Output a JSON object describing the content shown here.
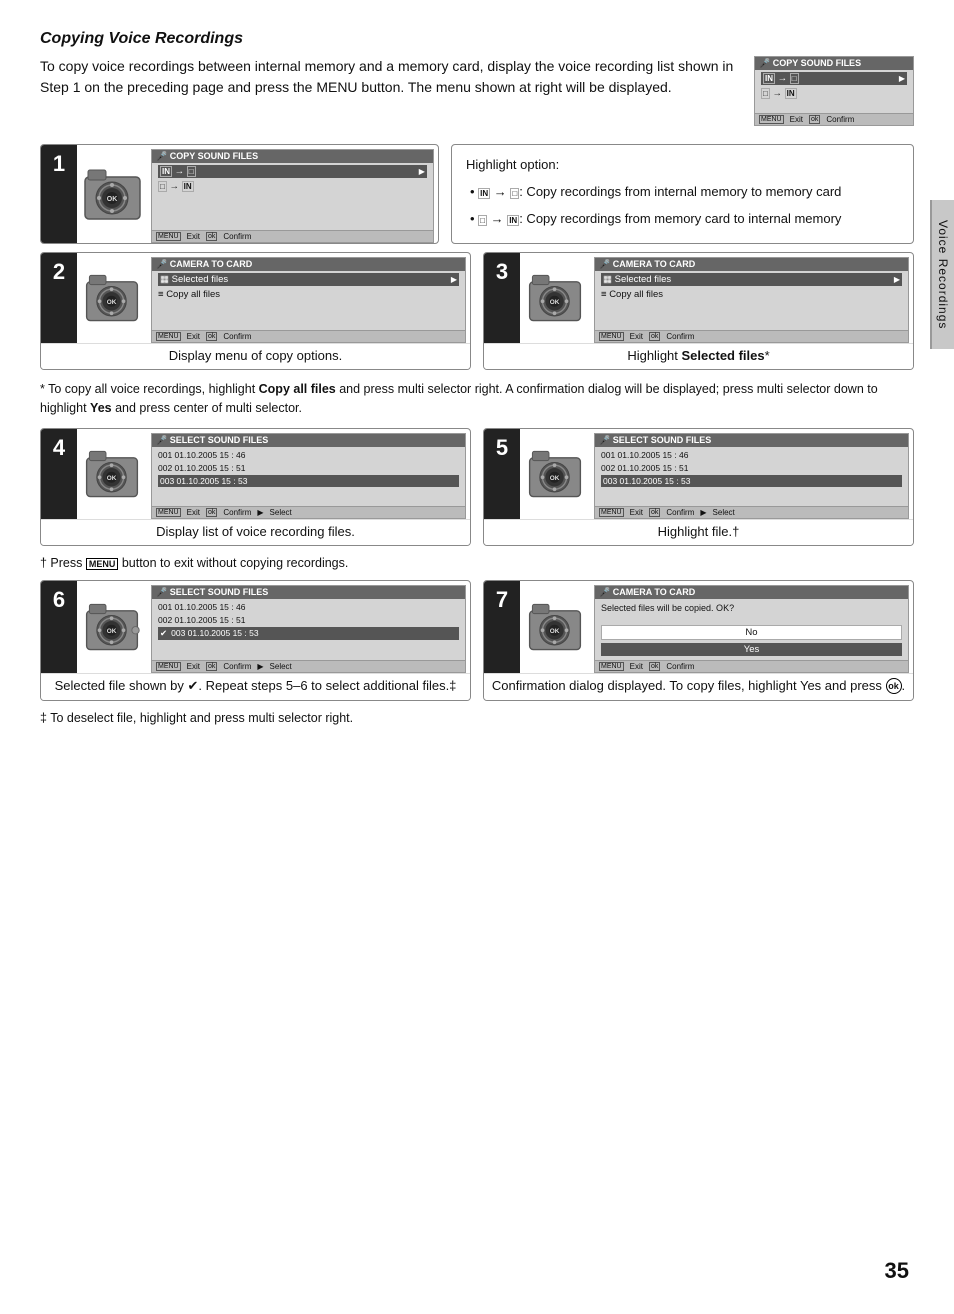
{
  "page": {
    "title": "Copying Voice Recordings",
    "intro": "To copy voice recordings between internal memory and a memory card, display the voice recording list shown in Step 1 on the preceding page and press the MENU button.  The menu shown at right will be displayed.",
    "menu_word": "MENU",
    "side_label": "Voice Recordings",
    "page_number": "35"
  },
  "intro_menu": {
    "title": "COPY SOUND FILES",
    "row1": "IN→CARD",
    "row2": "CARD→IN",
    "footer_exit": "Exit",
    "footer_confirm": "Confirm"
  },
  "step1": {
    "num": "1",
    "screen_title": "COPY SOUND FILES",
    "row1": "IN→CARD",
    "row2": "CARD→IN",
    "footer_exit": "Exit",
    "footer_confirm": "Confirm",
    "highlight_heading": "Highlight option:",
    "bullet1": ": Copy recordings from internal memory to memory card",
    "bullet2": ": Copy recordings from memory card to internal memory"
  },
  "step2": {
    "num": "2",
    "screen_title": "CAMERA TO CARD",
    "row1": "Selected files",
    "row2": "Copy all files",
    "footer_exit": "Exit",
    "footer_confirm": "Confirm",
    "caption": "Display menu of copy options."
  },
  "step3": {
    "num": "3",
    "screen_title": "CAMERA TO CARD",
    "row1": "Selected files",
    "row2": "Copy all files",
    "footer_exit": "Exit",
    "footer_confirm": "Confirm",
    "caption": "Highlight Selected files.",
    "caption_note": "*"
  },
  "note1": "* To copy all voice recordings, highlight Copy all files and press multi selector right.  A confirmation dialog will be displayed; press multi selector down to highlight Yes and press center of multi selector.",
  "step4": {
    "num": "4",
    "screen_title": "SELECT SOUND FILES",
    "rows": [
      "001 01.10.2005  15 : 46",
      "002 01.10.2005  15 : 51",
      "003 01.10.2005  15 : 53"
    ],
    "footer_exit": "Exit",
    "footer_confirm": "Confirm",
    "footer_select": "Select",
    "caption": "Display list of voice recording files."
  },
  "step5": {
    "num": "5",
    "screen_title": "SELECT SOUND FILES",
    "rows": [
      "001 01.10.2005  15 : 46",
      "002 01.10.2005  15 : 51",
      "003 01.10.2005  15 : 53"
    ],
    "footer_exit": "Exit",
    "footer_confirm": "Confirm",
    "footer_select": "Select",
    "caption": "Highlight file.",
    "caption_note": "†"
  },
  "note2": "† Press MENU button to exit without copying recordings.",
  "step6": {
    "num": "6",
    "screen_title": "SELECT SOUND FILES",
    "rows": [
      "001 01.10.2005  15 : 46",
      "002 01.10.2005  15 : 51",
      "003 01.10.2005  15 : 53"
    ],
    "checked_row": 2,
    "footer_exit": "Exit",
    "footer_confirm": "Confirm",
    "footer_select": "Select",
    "caption": "Selected file shown by ✔.  Repeat steps 5–6 to select additional files.‡"
  },
  "step7": {
    "num": "7",
    "screen_title": "CAMERA TO CARD",
    "confirm_text": "Selected files will be copied. OK?",
    "no_label": "No",
    "yes_label": "Yes",
    "footer_exit": "Exit",
    "footer_confirm": "Confirm",
    "caption": "Confirmation dialog displayed.  To copy files, highlight Yes and press "
  },
  "note3": "‡ To deselect file, highlight and press multi selector right."
}
